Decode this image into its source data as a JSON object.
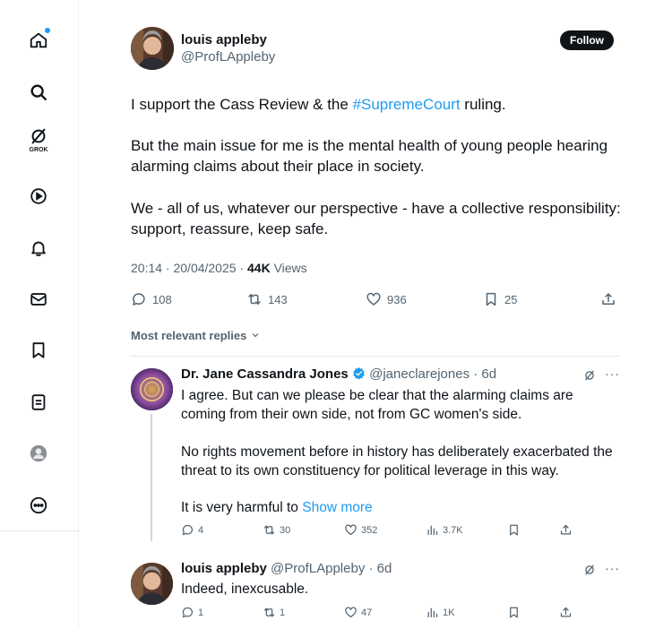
{
  "nav": {
    "grok_label": "GROK",
    "items": [
      "home-icon",
      "search-icon",
      "grok-icon",
      "video-icon",
      "notifications-icon",
      "messages-icon",
      "bookmarks-icon",
      "lists-icon",
      "profile-icon",
      "more-icon"
    ]
  },
  "tweet": {
    "author_name": "louis appleby",
    "author_handle": "@ProfLAppleby",
    "follow_label": "Follow",
    "line1_before": "I support the Cass Review & the ",
    "line1_hashtag": "#SupremeCourt",
    "line1_after": " ruling.",
    "para2": "But the main issue for me is the mental health of young people hearing alarming claims about their place in society.",
    "para3": "We - all of us, whatever our perspective - have a collective responsibility: support, reassure, keep safe.",
    "timestamp": "20:14 · 20/04/2025 · ",
    "views_count": "44K",
    "views_label": " Views",
    "replies": "108",
    "reposts": "143",
    "likes": "936",
    "bookmarks": "25"
  },
  "replies_header": "Most relevant replies",
  "reply1": {
    "name": "Dr. Jane Cassandra Jones",
    "handle": "@janeclarejones",
    "age": "· 6d",
    "para1": "I agree. But can we please be clear that the alarming claims are coming from their own side, not from GC women's side.",
    "para2": "No rights movement before in history has deliberately exacerbated the threat to its own constituency for political leverage in this way.",
    "para3": "It is very harmful to ",
    "show_more": "Show more",
    "replies": "4",
    "reposts": "30",
    "likes": "352",
    "views": "3.7K"
  },
  "reply2": {
    "name": "louis appleby",
    "handle": "@ProfLAppleby",
    "age": "· 6d",
    "text": "Indeed, inexcusable.",
    "replies": "1",
    "reposts": "1",
    "likes": "47",
    "views": "1K"
  },
  "colors": {
    "accent": "#1d9bf0",
    "text": "#0f1419",
    "muted": "#536471"
  }
}
